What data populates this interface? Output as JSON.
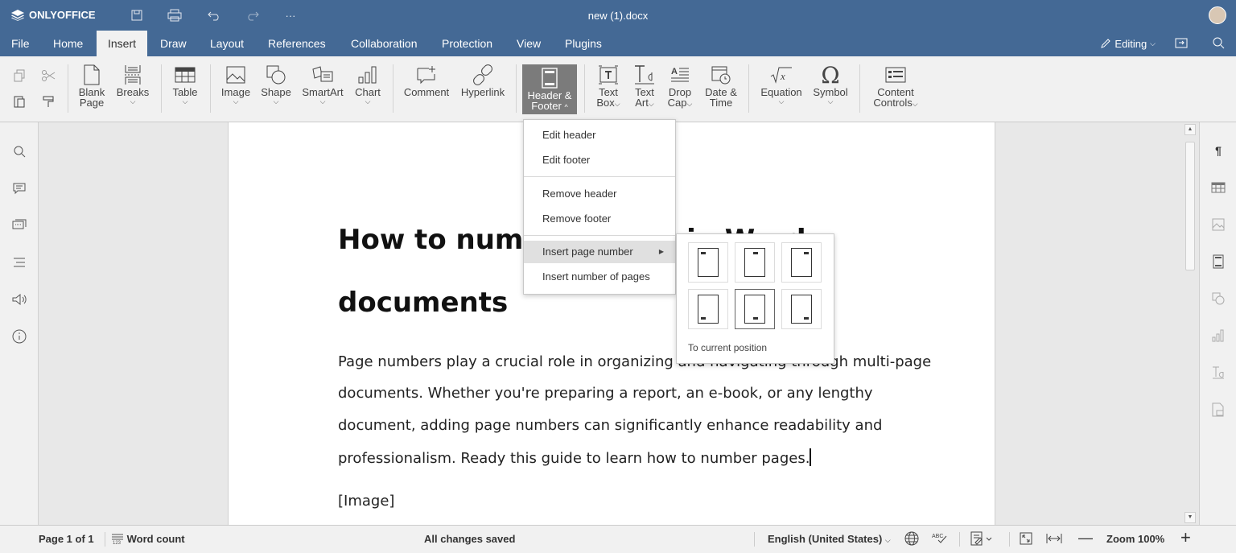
{
  "app": {
    "brand": "ONLYOFFICE",
    "doc_title": "new (1).docx",
    "more_label": "···"
  },
  "menu": {
    "tabs": [
      "File",
      "Home",
      "Insert",
      "Draw",
      "Layout",
      "References",
      "Collaboration",
      "Protection",
      "View",
      "Plugins"
    ],
    "active_tab": "Insert",
    "editing_label": "Editing"
  },
  "toolbar": {
    "blank_page": [
      "Blank",
      "Page"
    ],
    "breaks": "Breaks",
    "table": "Table",
    "image": "Image",
    "shape": "Shape",
    "smartart": "SmartArt",
    "chart": "Chart",
    "comment": "Comment",
    "hyperlink": "Hyperlink",
    "header_footer": [
      "Header &",
      "Footer"
    ],
    "text_box": [
      "Text",
      "Box"
    ],
    "text_art": [
      "Text",
      "Art"
    ],
    "drop_cap": [
      "Drop",
      "Cap"
    ],
    "date_time": [
      "Date &",
      "Time"
    ],
    "equation": "Equation",
    "symbol": "Symbol",
    "content_controls": [
      "Content",
      "Controls"
    ]
  },
  "document": {
    "heading_line1": "How to number pages in Word",
    "heading_line2": "documents",
    "paragraph_lines": [
      "Page numbers play a crucial role in organizing and navigating through multi-page",
      "documents. Whether you're preparing a report, an e-book, or any lengthy",
      "document, adding page numbers can significantly enhance readability and",
      "professionalism. Ready this guide to learn how to number pages."
    ],
    "image_placeholder": "[Image]"
  },
  "header_footer_menu": {
    "items": [
      "Edit header",
      "Edit footer",
      "Remove header",
      "Remove footer",
      "Insert page number",
      "Insert number of pages"
    ],
    "highlighted": "Insert page number"
  },
  "page_number_menu": {
    "current_position_label": "To current position",
    "positions": [
      "top-left",
      "top-center",
      "top-right",
      "bottom-left",
      "bottom-center",
      "bottom-right"
    ],
    "selected": "bottom-center"
  },
  "status": {
    "page_info": "Page 1 of 1",
    "word_count": "Word count",
    "save_status": "All changes saved",
    "language": "English (United States)",
    "zoom": "Zoom 100%"
  },
  "colors": {
    "header_bg": "#446995",
    "toolbar_bg": "#f1f1f1",
    "active_button": "#7b7b7b"
  }
}
